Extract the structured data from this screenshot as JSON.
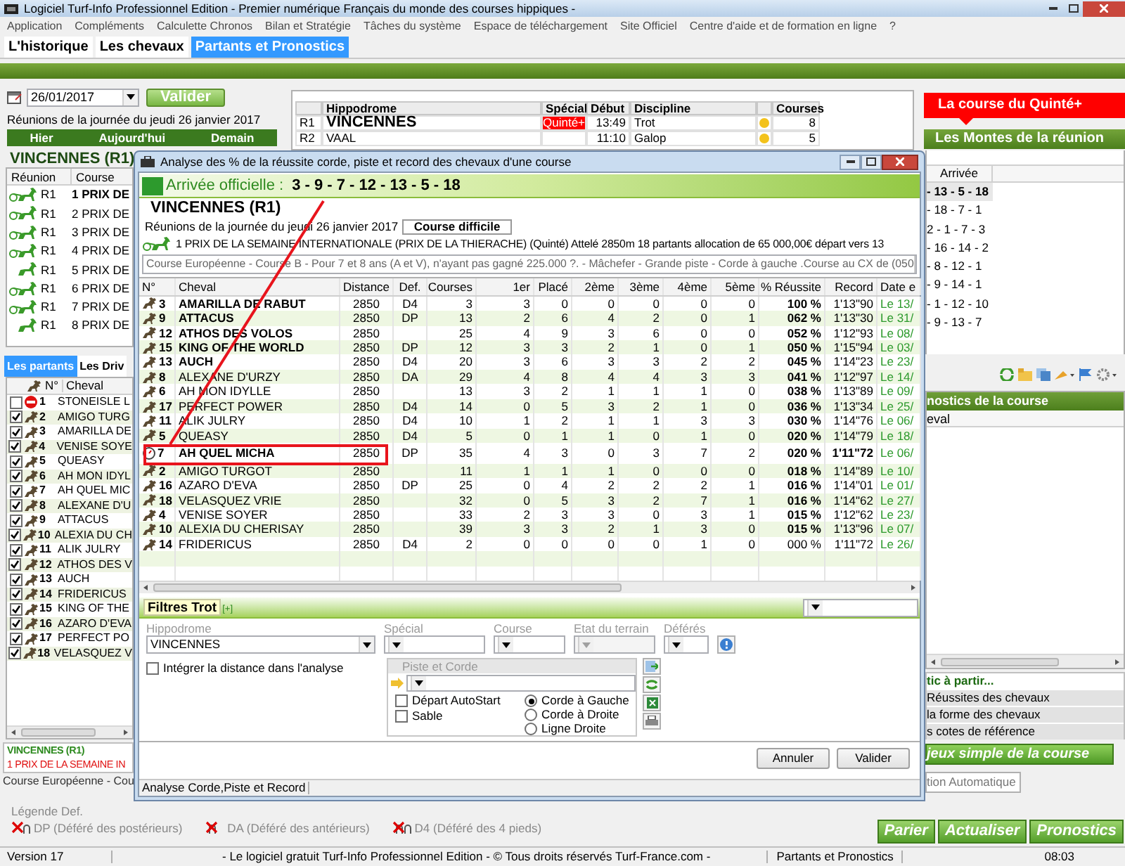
{
  "window": {
    "title": "Logiciel Turf-Info Professionnel Edition - Premier numérique Français du monde des courses hippiques -"
  },
  "menu": [
    "Application",
    "Compléments",
    "Calculette Chronos",
    "Bilan et Stratégie",
    "Tâches du système",
    "Espace de téléchargement",
    "Site Officiel",
    "Centre d'aide et de formation en ligne",
    "?"
  ],
  "tabs": [
    {
      "label": "L'historique",
      "selected": false
    },
    {
      "label": "Les chevaux",
      "selected": false
    },
    {
      "label": "Partants et Pronostics",
      "selected": true
    }
  ],
  "date_field": {
    "value": "26/01/2017"
  },
  "validate_button": "Valider",
  "day_caption": "Réunions de la journée du jeudi 26 janvier 2017",
  "day_nav": [
    "Hier",
    "Aujourd'hui",
    "Demain"
  ],
  "meetings_table": {
    "columns": [
      "Hippodrome",
      "Spécial",
      "Début",
      "Discipline",
      "Courses"
    ],
    "rows": [
      {
        "code": "R1",
        "hippodrome": "VINCENNES",
        "special": "Quinté+",
        "start": "13:49",
        "discipline": "Trot",
        "courses": "8",
        "selected": true
      },
      {
        "code": "R2",
        "hippodrome": "VAAL",
        "start": "11:10",
        "discipline": "Galop",
        "courses": "5",
        "selected": false
      }
    ]
  },
  "left_panel": {
    "meeting_title": "VINCENNES (R1)",
    "races_columns": [
      "Réunion",
      "Course"
    ],
    "races": [
      {
        "reunion": "R1",
        "course": "1 PRIX DE",
        "kind": "attele",
        "selected": true
      },
      {
        "reunion": "R1",
        "course": "2 PRIX DE",
        "kind": "attele",
        "selected": false
      },
      {
        "reunion": "R1",
        "course": "3 PRIX DE",
        "kind": "attele",
        "selected": false
      },
      {
        "reunion": "R1",
        "course": "4 PRIX DE",
        "kind": "attele",
        "selected": false
      },
      {
        "reunion": "R1",
        "course": "5 PRIX DE",
        "kind": "monte",
        "selected": false
      },
      {
        "reunion": "R1",
        "course": "6 PRIX DE",
        "kind": "attele",
        "selected": false
      },
      {
        "reunion": "R1",
        "course": "7 PRIX DE",
        "kind": "attele",
        "selected": false
      },
      {
        "reunion": "R1",
        "course": "8 PRIX DE",
        "kind": "monte",
        "selected": false
      }
    ],
    "runner_tabs": [
      {
        "label": "Les partants",
        "selected": true
      },
      {
        "label": "Les Driv",
        "selected": false
      }
    ],
    "runners_columns": [
      "N°",
      "Cheval"
    ],
    "runners": [
      {
        "number": "1",
        "name": "STONEISLE L",
        "kind": "scratched",
        "checked": false
      },
      {
        "number": "2",
        "name": "AMIGO TURG",
        "kind": "runner",
        "checked": true
      },
      {
        "number": "3",
        "name": "AMARILLA DE",
        "kind": "runner",
        "checked": true
      },
      {
        "number": "4",
        "name": "VENISE SOYE",
        "kind": "runner",
        "checked": true
      },
      {
        "number": "5",
        "name": "QUEASY",
        "kind": "runner",
        "checked": true
      },
      {
        "number": "6",
        "name": "AH MON IDYL",
        "kind": "runner",
        "checked": true
      },
      {
        "number": "7",
        "name": "AH QUEL MIC",
        "kind": "runner",
        "checked": true
      },
      {
        "number": "8",
        "name": "ALEXANE D'U",
        "kind": "runner",
        "checked": true
      },
      {
        "number": "9",
        "name": "ATTACUS",
        "kind": "runner",
        "checked": true
      },
      {
        "number": "10",
        "name": "ALEXIA DU CH",
        "kind": "runner",
        "checked": true
      },
      {
        "number": "11",
        "name": "ALIK JULRY",
        "kind": "runner",
        "checked": true
      },
      {
        "number": "12",
        "name": "ATHOS DES V",
        "kind": "runner",
        "checked": true
      },
      {
        "number": "13",
        "name": "AUCH",
        "kind": "runner",
        "checked": true
      },
      {
        "number": "14",
        "name": "FRIDERICUS",
        "kind": "runner",
        "checked": true
      },
      {
        "number": "15",
        "name": "KING OF THE",
        "kind": "runner",
        "checked": true
      },
      {
        "number": "16",
        "name": "AZARO D'EVA",
        "kind": "runner",
        "checked": true
      },
      {
        "number": "17",
        "name": "PERFECT PO",
        "kind": "runner",
        "checked": true
      },
      {
        "number": "18",
        "name": "VELASQUEZ V",
        "kind": "runner",
        "checked": true
      }
    ],
    "race_box": {
      "title": "VINCENNES (R1)",
      "race": "1 PRIX DE LA SEMAINE IN"
    },
    "race_conditions": "Course Européenne - Cou"
  },
  "legend": {
    "title": "Légende Def.",
    "items": [
      {
        "kind": "hind",
        "text": "DP (Déféré des postérieurs)"
      },
      {
        "kind": "front",
        "text": "DA (Déféré des antérieurs)"
      },
      {
        "kind": "all",
        "text": "D4 (Déféré des 4 pieds)"
      }
    ]
  },
  "right_panel": {
    "quinte_banner": "La course du Quinté+",
    "montes_banner": "Les Montes de la réunion",
    "arrivals_column": "Arrivée",
    "arrivals": [
      {
        "text": "- 13 - 5 - 18",
        "selected": true
      },
      {
        "text": "- 18 - 7 - 1",
        "selected": false
      },
      {
        "text": "2 - 1 - 7 - 3",
        "selected": false
      },
      {
        "text": "- 16 - 14 - 2",
        "selected": false
      },
      {
        "text": "- 8 - 12 - 1",
        "selected": false
      },
      {
        "text": "- 9 - 14 - 1",
        "selected": false
      },
      {
        "text": "- 1 - 12 - 10",
        "selected": false
      },
      {
        "text": "- 9 - 13 - 7",
        "selected": false
      }
    ],
    "forecast_header": "nostics de la course",
    "forecast_column": "eval",
    "forecast_group": {
      "title": "tic à partir...",
      "options": [
        "Réussites des chevaux",
        "la forme des chevaux",
        "s cotes de référence"
      ]
    },
    "simple_bets_button": "jeux simple de la course",
    "auto_button": "tion Automatique",
    "action_buttons": [
      "Parier",
      "Actualiser",
      "Pronostics"
    ]
  },
  "status_bar": [
    "Version 17",
    "- Le logiciel gratuit Turf-Info Professionnel Edition - © Tous droits réservés Turf-France.com -",
    "Partants et Pronostics",
    "08:03"
  ],
  "dialog": {
    "title": "Analyse des % de la réussite corde, piste et record des chevaux d'une course",
    "arrival_label": "Arrivée officielle :",
    "arrival": "3 - 9 - 7 - 12 - 13 - 5 - 18",
    "meeting": "VINCENNES (R1)",
    "caption": "Réunions de la journée du jeudi 26 janvier 2017",
    "difficulty_button": "Course difficile",
    "race": "1 PRIX DE LA SEMAINE INTERNATIONALE (PRIX DE LA THIERACHE) (Quinté) Attelé 2850m 18 partants allocation de 65 000,00€ départ vers 13",
    "conditions": "Course Européenne - Course B - Pour 7 et 8 ans (A et V), n'ayant pas gagné 225.000 ?. - Mâchefer - Grande piste - Corde à gauche .Course au CX de (050",
    "table": {
      "columns": [
        "N°",
        "Cheval",
        "Distance",
        "Def.",
        "Courses",
        "1er",
        "Placé",
        "2ème",
        "3ème",
        "4ème",
        "5ème",
        "% Réussite",
        "Record",
        "Date e"
      ],
      "rows": [
        {
          "number": "3",
          "name": "AMARILLA DE RABUT",
          "bold": true,
          "flagged": false,
          "distance": "2850",
          "def": "D4",
          "courses": "3",
          "first": "3",
          "place": "0",
          "second": "0",
          "third": "0",
          "fourth": "0",
          "fifth": "0",
          "rate": "100 %",
          "rate_bold": true,
          "record": "1'13\"90",
          "date": "Le 13/"
        },
        {
          "number": "9",
          "name": "ATTACUS",
          "bold": true,
          "flagged": false,
          "distance": "2850",
          "def": "DP",
          "courses": "13",
          "first": "2",
          "place": "6",
          "second": "4",
          "third": "2",
          "fourth": "0",
          "fifth": "1",
          "rate": "062 %",
          "rate_bold": true,
          "record": "1'13\"30",
          "date": "Le 31/"
        },
        {
          "number": "12",
          "name": "ATHOS DES VOLOS",
          "bold": true,
          "flagged": false,
          "distance": "2850",
          "courses": "25",
          "first": "4",
          "place": "9",
          "second": "3",
          "third": "6",
          "fourth": "0",
          "fifth": "0",
          "rate": "052 %",
          "rate_bold": true,
          "record": "1'12\"93",
          "date": "Le 08/"
        },
        {
          "number": "15",
          "name": "KING OF THE WORLD",
          "bold": true,
          "flagged": false,
          "distance": "2850",
          "def": "DP",
          "courses": "12",
          "first": "3",
          "place": "3",
          "second": "2",
          "third": "1",
          "fourth": "0",
          "fifth": "1",
          "rate": "050 %",
          "rate_bold": true,
          "record": "1'15\"94",
          "date": "Le 03/"
        },
        {
          "number": "13",
          "name": "AUCH",
          "bold": true,
          "flagged": false,
          "distance": "2850",
          "def": "D4",
          "courses": "20",
          "first": "3",
          "place": "6",
          "second": "3",
          "third": "3",
          "fourth": "2",
          "fifth": "2",
          "rate": "045 %",
          "rate_bold": true,
          "record": "1'14\"23",
          "date": "Le 23/"
        },
        {
          "number": "8",
          "name": "ALEXANE D'URZY",
          "bold": false,
          "flagged": false,
          "distance": "2850",
          "def": "DA",
          "courses": "29",
          "first": "4",
          "place": "8",
          "second": "4",
          "third": "4",
          "fourth": "3",
          "fifth": "3",
          "rate": "041 %",
          "rate_bold": true,
          "record": "1'12\"97",
          "date": "Le 14/"
        },
        {
          "number": "6",
          "name": "AH MON IDYLLE",
          "bold": false,
          "flagged": false,
          "distance": "2850",
          "courses": "13",
          "first": "3",
          "place": "2",
          "second": "1",
          "third": "1",
          "fourth": "1",
          "fifth": "0",
          "rate": "038 %",
          "rate_bold": true,
          "record": "1'13\"89",
          "date": "Le 09/"
        },
        {
          "number": "17",
          "name": "PERFECT POWER",
          "bold": false,
          "flagged": false,
          "distance": "2850",
          "def": "D4",
          "courses": "14",
          "first": "0",
          "place": "5",
          "second": "3",
          "third": "2",
          "fourth": "1",
          "fifth": "0",
          "rate": "036 %",
          "rate_bold": true,
          "record": "1'13\"34",
          "date": "Le 25/"
        },
        {
          "number": "11",
          "name": "ALIK JULRY",
          "bold": false,
          "flagged": false,
          "distance": "2850",
          "def": "D4",
          "courses": "10",
          "first": "1",
          "place": "2",
          "second": "1",
          "third": "1",
          "fourth": "3",
          "fifth": "3",
          "rate": "030 %",
          "rate_bold": true,
          "record": "1'14\"76",
          "date": "Le 06/"
        },
        {
          "number": "5",
          "name": "QUEASY",
          "bold": false,
          "flagged": false,
          "distance": "2850",
          "def": "D4",
          "courses": "5",
          "first": "0",
          "place": "1",
          "second": "1",
          "third": "0",
          "fourth": "1",
          "fifth": "0",
          "rate": "020 %",
          "rate_bold": true,
          "record": "1'14\"79",
          "date": "Le 18/"
        },
        {
          "number": "7",
          "name": "AH QUEL MICHA",
          "bold": true,
          "flagged": true,
          "distance": "2850",
          "def": "DP",
          "courses": "35",
          "first": "4",
          "place": "3",
          "second": "0",
          "third": "3",
          "fourth": "7",
          "fifth": "2",
          "rate": "020 %",
          "rate_bold": true,
          "record": "1'11\"72",
          "date": "Le 06/"
        },
        {
          "number": "2",
          "name": "AMIGO TURGOT",
          "bold": false,
          "flagged": false,
          "distance": "2850",
          "courses": "11",
          "first": "1",
          "place": "1",
          "second": "1",
          "third": "0",
          "fourth": "0",
          "fifth": "0",
          "rate": "018 %",
          "rate_bold": true,
          "record": "1'14\"89",
          "date": "Le 10/"
        },
        {
          "number": "16",
          "name": "AZARO D'EVA",
          "bold": false,
          "flagged": false,
          "distance": "2850",
          "def": "DP",
          "courses": "25",
          "first": "0",
          "place": "4",
          "second": "2",
          "third": "2",
          "fourth": "2",
          "fifth": "1",
          "rate": "016 %",
          "rate_bold": true,
          "record": "1'14\"01",
          "date": "Le 01/"
        },
        {
          "number": "18",
          "name": "VELASQUEZ VRIE",
          "bold": false,
          "flagged": false,
          "distance": "2850",
          "courses": "32",
          "first": "0",
          "place": "5",
          "second": "3",
          "third": "2",
          "fourth": "7",
          "fifth": "1",
          "rate": "016 %",
          "rate_bold": true,
          "record": "1'14\"62",
          "date": "Le 27/"
        },
        {
          "number": "4",
          "name": "VENISE SOYER",
          "bold": false,
          "flagged": false,
          "distance": "2850",
          "courses": "33",
          "first": "2",
          "place": "3",
          "second": "3",
          "third": "0",
          "fourth": "3",
          "fifth": "1",
          "rate": "015 %",
          "rate_bold": true,
          "record": "1'12\"62",
          "date": "Le 23/"
        },
        {
          "number": "10",
          "name": "ALEXIA DU CHERISAY",
          "bold": false,
          "flagged": false,
          "distance": "2850",
          "courses": "39",
          "first": "3",
          "place": "3",
          "second": "2",
          "third": "1",
          "fourth": "3",
          "fifth": "0",
          "rate": "015 %",
          "rate_bold": true,
          "record": "1'13\"96",
          "date": "Le 07/"
        },
        {
          "number": "14",
          "name": "FRIDERICUS",
          "bold": false,
          "flagged": false,
          "distance": "2850",
          "def": "D4",
          "courses": "2",
          "first": "0",
          "place": "0",
          "second": "0",
          "third": "0",
          "fourth": "1",
          "fifth": "0",
          "rate": "000 %",
          "rate_bold": false,
          "record": "1'11\"72",
          "date": "Le 26/"
        }
      ]
    },
    "filters": {
      "title": "Filtres Trot",
      "expand": "[+]",
      "fields": [
        {
          "label": "Hippodrome",
          "value": "VINCENNES",
          "disabled": false
        },
        {
          "label": "Spécial",
          "disabled": false
        },
        {
          "label": "Course",
          "disabled": false
        },
        {
          "label": "Etat du terrain",
          "disabled": true
        },
        {
          "label": "Déférés",
          "disabled": false
        }
      ],
      "distance_option": {
        "label": "Intégrer la distance dans l'analyse",
        "checked": false
      },
      "track_group": {
        "title": "Piste et Corde",
        "checks": [
          {
            "label": "Départ AutoStart",
            "checked": false
          },
          {
            "label": "Sable",
            "checked": false
          }
        ],
        "radios": [
          {
            "label": "Corde à Gauche",
            "selected": true
          },
          {
            "label": "Corde à Droite",
            "selected": false
          },
          {
            "label": "Ligne Droite",
            "selected": false
          }
        ]
      }
    },
    "buttons": [
      "Annuler",
      "Valider"
    ],
    "status": "Analyse Corde,Piste et Record"
  }
}
